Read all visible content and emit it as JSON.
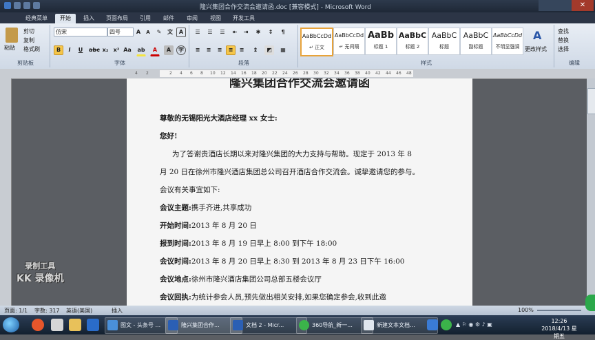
{
  "window": {
    "title": "隆兴集团合作交流会邀请函.doc [兼容模式] - Microsoft Word",
    "close_glyph": "✕"
  },
  "tabs": [
    "经典菜单",
    "开始",
    "插入",
    "页面布局",
    "引用",
    "邮件",
    "审阅",
    "视图",
    "开发工具"
  ],
  "active_tab": "开始",
  "ribbon": {
    "clipboard": {
      "paste": "粘贴",
      "cut": "剪切",
      "copy": "复制",
      "format_painter": "格式刷",
      "label": "剪贴板"
    },
    "font": {
      "font_name": "仿宋",
      "font_size": "四号",
      "label": "字体"
    },
    "paragraph": {
      "label": "段落"
    },
    "styles": {
      "label": "样式",
      "items": [
        {
          "preview": "AaBbCcDd",
          "name": "↵ 正文"
        },
        {
          "preview": "AaBbCcDd",
          "name": "↵ 无间隔"
        },
        {
          "preview": "AaBb",
          "name": "标题 1"
        },
        {
          "preview": "AaBbC",
          "name": "标题 2"
        },
        {
          "preview": "AaBbC",
          "name": "标题"
        },
        {
          "preview": "AaBbC",
          "name": "副标题"
        },
        {
          "preview": "AaBbCcDd",
          "name": "不明显强调"
        }
      ],
      "change_styles": "更改样式"
    },
    "editing": {
      "find": "查找",
      "replace": "替换",
      "select": "选择",
      "label": "编辑"
    }
  },
  "ruler": {
    "ticks": [
      "4",
      "2",
      "2",
      "4",
      "6",
      "8",
      "10",
      "12",
      "14",
      "16",
      "18",
      "20",
      "22",
      "24",
      "26",
      "28",
      "30",
      "32",
      "34",
      "36",
      "38",
      "40",
      "42",
      "44",
      "46",
      "48"
    ]
  },
  "document": {
    "title": "隆兴集团合作交流会邀请函",
    "salutation": "尊敬的无锡阳光大酒店经理 xx 女士:",
    "greeting": "您好!",
    "body1": "为了答谢贵酒店长期以来对隆兴集团的大力支持与帮助。现定于 2013 年 8",
    "body2": "月 20 日在徐州市隆兴酒店集团总公司召开酒店合作交流会。诚挚邀请您的参与。",
    "intro": "会议有关事宜如下:",
    "items": [
      {
        "label": "会议主题:",
        "value": "携手齐进,共享成功"
      },
      {
        "label": "开始时间:",
        "value": "2013 年 8 月 20 日"
      },
      {
        "label": "报到时间:",
        "value": "2013 年 8 月 19 日早上 8:00 到下午 18:00"
      },
      {
        "label": "会议时间:",
        "value": "2013 年 8 月 20 日早上 8:30 到 2013 年 8 月 23 日下午 16:00"
      },
      {
        "label": "会议地点:",
        "value": "徐州市隆兴酒店集团公司总部五楼会议厅"
      },
      {
        "label": "会议回执:",
        "value": "为统计参会人员,预先做出相关安排,如果您确定参会,收到此邀"
      }
    ]
  },
  "statusbar": {
    "page": "页面: 1/1",
    "words": "字数: 317",
    "language": "英语(美国)",
    "mode": "插入",
    "zoom": "100%"
  },
  "watermark": {
    "line1": "录制工具",
    "line2": "KK 录像机"
  },
  "taskbar": {
    "apps": [
      "图文 - 头条号 ...",
      "隆兴集团合作...",
      "文档 2 - Micr...",
      "360导航_新一...",
      "新建文本文档..."
    ],
    "time": "12:26",
    "date": "2018/4/13 星期五"
  }
}
